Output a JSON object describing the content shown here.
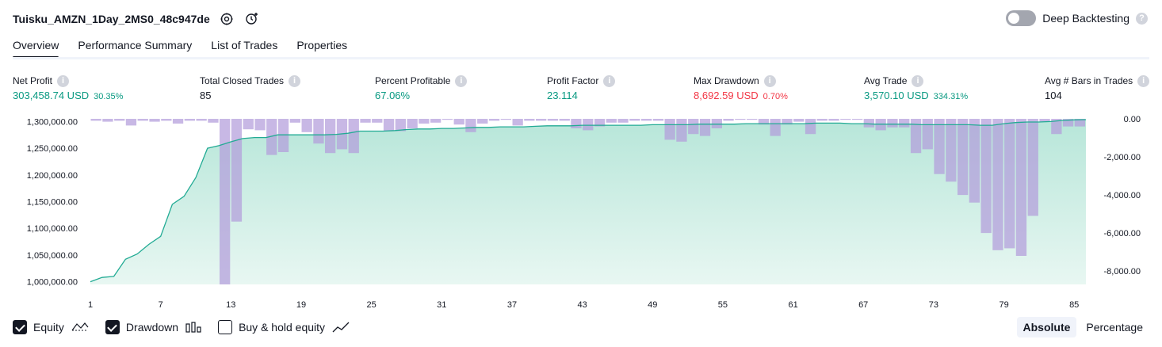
{
  "header": {
    "strategy_name": "Tuisku_AMZN_1Day_2MS0_48c947de",
    "deep_backtesting_label": "Deep Backtesting"
  },
  "tabs": [
    {
      "label": "Overview",
      "active": true
    },
    {
      "label": "Performance Summary",
      "active": false
    },
    {
      "label": "List of Trades",
      "active": false
    },
    {
      "label": "Properties",
      "active": false
    }
  ],
  "metrics": {
    "net_profit": {
      "label": "Net Profit",
      "value": "303,458.74 USD",
      "pct": "30.35%"
    },
    "total_closed_trades": {
      "label": "Total Closed Trades",
      "value": "85"
    },
    "percent_profitable": {
      "label": "Percent Profitable",
      "value": "67.06%"
    },
    "profit_factor": {
      "label": "Profit Factor",
      "value": "23.114"
    },
    "max_drawdown": {
      "label": "Max Drawdown",
      "value": "8,692.59 USD",
      "pct": "0.70%"
    },
    "avg_trade": {
      "label": "Avg Trade",
      "value": "3,570.10 USD",
      "pct": "334.31%"
    },
    "avg_bars": {
      "label": "Avg # Bars in Trades",
      "value": "104"
    }
  },
  "colors": {
    "positive": "#089981",
    "negative": "#f23645",
    "equity_line": "#22ab94",
    "equity_fill": "#cbeee5",
    "drawdown_bar": "#b39ddb"
  },
  "chart_data": {
    "type": "line",
    "left_axis": {
      "ylim": [
        995000,
        1305000
      ],
      "ticks": [
        "1,300,000.00",
        "1,250,000.00",
        "1,200,000.00",
        "1,150,000.00",
        "1,100,000.00",
        "1,050,000.00",
        "1,000,000.00"
      ],
      "tick_values": [
        1300000,
        1250000,
        1200000,
        1150000,
        1100000,
        1050000,
        1000000
      ]
    },
    "right_axis": {
      "ylim": [
        -8700,
        0
      ],
      "ticks": [
        "0.00",
        "-2,000.00",
        "-4,000.00",
        "-6,000.00",
        "-8,000.00"
      ],
      "tick_values": [
        0,
        -2000,
        -4000,
        -6000,
        -8000
      ]
    },
    "x_ticks": [
      "1",
      "7",
      "13",
      "19",
      "25",
      "31",
      "37",
      "43",
      "49",
      "55",
      "61",
      "67",
      "73",
      "79",
      "85"
    ],
    "x_tick_values": [
      1,
      7,
      13,
      19,
      25,
      31,
      37,
      43,
      49,
      55,
      61,
      67,
      73,
      79,
      85
    ],
    "equity": {
      "name": "Equity",
      "x": [
        1,
        2,
        3,
        4,
        5,
        6,
        7,
        8,
        9,
        10,
        11,
        12,
        13,
        14,
        15,
        16,
        17,
        18,
        19,
        20,
        21,
        22,
        23,
        24,
        25,
        26,
        27,
        28,
        29,
        30,
        31,
        32,
        33,
        34,
        35,
        36,
        37,
        38,
        39,
        40,
        41,
        42,
        43,
        44,
        45,
        46,
        47,
        48,
        49,
        50,
        51,
        52,
        53,
        54,
        55,
        56,
        57,
        58,
        59,
        60,
        61,
        62,
        63,
        64,
        65,
        66,
        67,
        68,
        69,
        70,
        71,
        72,
        73,
        74,
        75,
        76,
        77,
        78,
        79,
        80,
        81,
        82,
        83,
        84,
        85,
        86
      ],
      "values": [
        1000000,
        1008000,
        1010000,
        1042000,
        1052000,
        1070000,
        1085000,
        1145000,
        1160000,
        1195000,
        1250000,
        1255000,
        1262000,
        1268000,
        1270000,
        1270000,
        1275000,
        1275000,
        1275000,
        1275000,
        1275000,
        1276000,
        1278000,
        1282000,
        1282000,
        1282000,
        1283000,
        1285000,
        1286000,
        1286000,
        1287000,
        1287000,
        1288000,
        1289000,
        1289000,
        1290000,
        1290000,
        1290000,
        1291000,
        1292000,
        1292000,
        1292000,
        1293000,
        1293000,
        1293000,
        1293000,
        1293000,
        1293000,
        1294000,
        1294000,
        1294000,
        1294000,
        1295000,
        1295000,
        1295000,
        1295000,
        1296000,
        1296000,
        1296000,
        1296000,
        1296000,
        1296000,
        1297000,
        1297000,
        1297000,
        1296000,
        1296000,
        1295000,
        1295000,
        1295000,
        1295000,
        1294000,
        1294000,
        1294000,
        1294000,
        1294000,
        1293000,
        1293000,
        1296000,
        1298000,
        1299000,
        1299000,
        1300000,
        1302000,
        1303000,
        1303500
      ]
    },
    "drawdown": {
      "name": "Drawdown",
      "x": [
        1,
        2,
        3,
        4,
        5,
        6,
        7,
        8,
        9,
        10,
        11,
        12,
        13,
        14,
        15,
        16,
        17,
        18,
        19,
        20,
        21,
        22,
        23,
        24,
        25,
        26,
        27,
        28,
        29,
        30,
        31,
        32,
        33,
        34,
        35,
        36,
        37,
        38,
        39,
        40,
        41,
        42,
        43,
        44,
        45,
        46,
        47,
        48,
        49,
        50,
        51,
        52,
        53,
        54,
        55,
        56,
        57,
        58,
        59,
        60,
        61,
        62,
        63,
        64,
        65,
        66,
        67,
        68,
        69,
        70,
        71,
        72,
        73,
        74,
        75,
        76,
        77,
        78,
        79,
        80,
        81,
        82,
        83,
        84,
        85
      ],
      "values": [
        -100,
        -150,
        -100,
        -350,
        -100,
        -150,
        -100,
        -250,
        -100,
        -100,
        -200,
        -8700,
        -5400,
        -550,
        -600,
        -1900,
        -1750,
        -200,
        -700,
        -1300,
        -1800,
        -1600,
        -1800,
        -200,
        -200,
        -650,
        -650,
        -500,
        -250,
        -200,
        -50,
        -300,
        -700,
        -250,
        -100,
        -50,
        -350,
        -100,
        -100,
        -100,
        -100,
        -500,
        -600,
        -400,
        -200,
        -200,
        -100,
        -100,
        -100,
        -1100,
        -1200,
        -800,
        -900,
        -500,
        -100,
        -50,
        -50,
        -300,
        -900,
        -300,
        -150,
        -800,
        -100,
        -100,
        -50,
        -50,
        -450,
        -600,
        -450,
        -450,
        -1800,
        -1600,
        -2900,
        -3300,
        -4000,
        -4400,
        -6000,
        -6900,
        -6800,
        -7200,
        -5100,
        -150,
        -800,
        -400,
        -400,
        -1000,
        -100,
        -400
      ]
    }
  },
  "legend": {
    "equity": {
      "label": "Equity",
      "checked": true
    },
    "drawdown": {
      "label": "Drawdown",
      "checked": true
    },
    "buy_hold": {
      "label": "Buy & hold equity",
      "checked": false
    }
  },
  "view_toggle": {
    "absolute": "Absolute",
    "percentage": "Percentage",
    "active": "absolute"
  }
}
